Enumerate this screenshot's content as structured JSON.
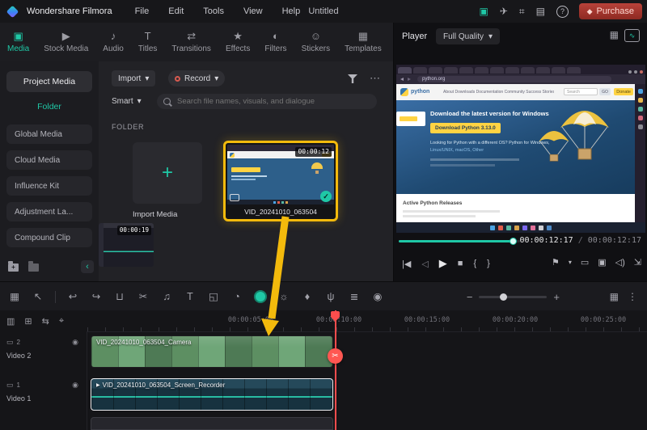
{
  "glyphs": {
    "caret": "▾",
    "more": "⋯",
    "check": "✓",
    "plus": "+",
    "scissors": "✂",
    "collapse": "‹",
    "play": "▶"
  },
  "topbar": {
    "brand": "Wondershare Filmora",
    "menus": [
      "File",
      "Edit",
      "Tools",
      "View",
      "Help"
    ],
    "project_title": "Untitled",
    "purchase_label": "Purchase",
    "icons": {
      "gift": "▣",
      "send": "✈",
      "capture": "⌗",
      "devices": "▤",
      "help": "?",
      "cart": "◆"
    }
  },
  "tabs": [
    {
      "icon": "▣",
      "label": "Media"
    },
    {
      "icon": "▶",
      "label": "Stock Media"
    },
    {
      "icon": "♪",
      "label": "Audio"
    },
    {
      "icon": "T",
      "label": "Titles"
    },
    {
      "icon": "⇄",
      "label": "Transitions"
    },
    {
      "icon": "★",
      "label": "Effects"
    },
    {
      "icon": "◐",
      "label": "Filters"
    },
    {
      "icon": "☺",
      "label": "Stickers"
    },
    {
      "icon": "▦",
      "label": "Templates"
    }
  ],
  "sidebar": {
    "project_media": "Project Media",
    "folder": "Folder",
    "items": [
      "Global Media",
      "Cloud Media",
      "Influence Kit",
      "Adjustment La...",
      "Compound Clip"
    ]
  },
  "media": {
    "import_button": "Import",
    "record_button": "Record",
    "smart_filter": "Smart",
    "search_placeholder": "Search file names, visuals, and dialogue",
    "section_label": "FOLDER",
    "import_tile_label": "Import Media",
    "clip_name": "VID_20241010_063504",
    "clip_duration": "00:00:12",
    "clip2_duration": "00:00:19"
  },
  "player": {
    "label": "Player",
    "quality": "Full Quality",
    "current_time": "00:00:12:17",
    "separator": "/",
    "total_time": "00:00:12:17",
    "icons": {
      "layout": "▦",
      "scope": "∿"
    }
  },
  "preview": {
    "url": "python.org",
    "brand": "python",
    "nav": "About   Downloads   Documentation   Community   Success Stories   News   Events",
    "search_placeholder": "Search",
    "go": "GO",
    "donate": "Donate",
    "hero_title": "Download the latest version for Windows",
    "hero_button": "Download Python 3.13.0",
    "hero_note": "Looking for Python with a different OS? Python for Windows,",
    "hero_links": "Linux/UNIX, macOS, Other",
    "releases_heading": "Active Python Releases"
  },
  "transport": {
    "skip_back": "|◀",
    "play_reverse": "◁",
    "play": "▶",
    "stop": "■",
    "mark_in": "{",
    "mark_out": "}",
    "flag": "⚑",
    "caret": "▾",
    "screen": "▭",
    "snapshot": "▣",
    "volume": "◁)",
    "fullscreen": "⇲"
  },
  "toolbar": {
    "group1": [
      "▦",
      "↖"
    ],
    "group2": [
      "↩",
      "↪",
      "⊔",
      "✂",
      "♫",
      "T",
      "◱",
      "◔"
    ],
    "group3": [
      "☼",
      "♦",
      "ψ",
      "≣",
      "◉"
    ],
    "right": [
      "▦",
      "⋮"
    ],
    "zoom_minus": "−",
    "zoom_plus": "+"
  },
  "timeline": {
    "tools": [
      "▥",
      "⊞",
      "⇆",
      "⌖"
    ],
    "ruler": [
      "00:00:05:00",
      "00:00:10:00",
      "00:00:15:00",
      "00:00:20:00",
      "00:00:25:00"
    ],
    "track_icons": {
      "screen": "▭",
      "eye": "◉"
    },
    "tracks": [
      {
        "label": "Video 2",
        "number": "2",
        "clip_name": "VID_20241010_063504_Camera"
      },
      {
        "label": "Video 1",
        "number": "1",
        "clip_name": "VID_20241010_063504_Screen_Recorder"
      }
    ]
  },
  "colors": {
    "accent": "#1fc8a6",
    "annotation": "#f3ba0c",
    "playhead": "#ff4d4d",
    "purchase_red": "#8e2a22",
    "python_blue": "#2b5b84",
    "python_yellow": "#ffd343"
  }
}
